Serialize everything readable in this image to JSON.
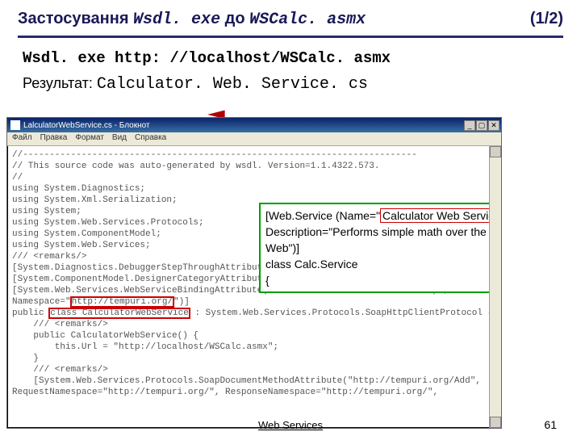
{
  "title": {
    "prefix": "Застосування ",
    "code1": "Wsdl. exe",
    "mid": " до ",
    "code2": "WSCalc. asmx",
    "pager": "(1/2)"
  },
  "command": "Wsdl. exe http: //localhost/WSCalc. asmx",
  "result": {
    "label": "Результат: ",
    "file": "Calculator. Web. Service. cs"
  },
  "notepad": {
    "title": "LalculatorWebService.cs - Блокнот",
    "menu": [
      "Файл",
      "Правка",
      "Формат",
      "Вид",
      "Справка"
    ],
    "win_buttons": [
      "_",
      "▢",
      "✕"
    ],
    "lines": [
      "//--------------------------------------------------------------------------",
      "// This source code was auto-generated by wsdl. Version=1.1.4322.573.",
      "//",
      "using System.Diagnostics;",
      "using System.Xml.Serialization;",
      "using System;",
      "using System.Web.Services.Protocols;",
      "using System.ComponentModel;",
      "using System.Web.Services;",
      "",
      "",
      "/// <remarks/>",
      "[System.Diagnostics.DebuggerStepThroughAttribute()]",
      "[System.ComponentModel.DesignerCategoryAttribute(\"code\")]",
      "[System.Web.Services.WebServiceBindingAttribute(Name=\"Calculator Web ServiceSoap\",",
      "Namespace=\"http://tempuri.org/\")]",
      "public class CalculatorWebService : System.Web.Services.Protocols.SoapHttpClientProtocol {",
      "",
      "    /// <remarks/>",
      "    public CalculatorWebService() {",
      "        this.Url = \"http://localhost/WSCalc.asmx\";",
      "    }",
      "",
      "    /// <remarks/>",
      "    [System.Web.Services.Protocols.SoapDocumentMethodAttribute(\"http://tempuri.org/Add\",",
      "RequestNamespace=\"http://tempuri.org/\", ResponseNamespace=\"http://tempuri.org/\","
    ],
    "highlight": {
      "ns_line_index": 15,
      "class_line_index": 16
    }
  },
  "callout": {
    "l1a": "[Web.Service (Name=\"",
    "l1b": "Calculator Web Service",
    "l1c": "\",",
    "l2": "   Description=\"Performs simple math over the Web\")]",
    "l3": "class Calc.Service",
    "l4": "{"
  },
  "footer": {
    "center": "Web Services",
    "page": "61"
  }
}
